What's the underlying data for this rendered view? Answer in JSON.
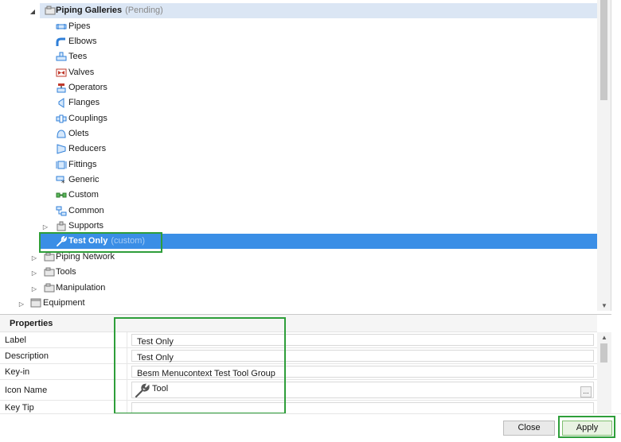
{
  "tree": {
    "nodes": [
      {
        "label": "Piping Galleries",
        "status": "(Pending)",
        "icon": "gallery-icon"
      },
      {
        "label": "Pipes",
        "icon": "pipe-icon"
      },
      {
        "label": "Elbows",
        "icon": "elbow-icon"
      },
      {
        "label": "Tees",
        "icon": "tee-icon"
      },
      {
        "label": "Valves",
        "icon": "valve-icon"
      },
      {
        "label": "Operators",
        "icon": "operator-icon"
      },
      {
        "label": "Flanges",
        "icon": "flange-icon"
      },
      {
        "label": "Couplings",
        "icon": "coupling-icon"
      },
      {
        "label": "Olets",
        "icon": "olet-icon"
      },
      {
        "label": "Reducers",
        "icon": "reducer-icon"
      },
      {
        "label": "Fittings",
        "icon": "fitting-icon"
      },
      {
        "label": "Generic",
        "icon": "generic-icon"
      },
      {
        "label": "Custom",
        "icon": "custom-icon"
      },
      {
        "label": "Common",
        "icon": "common-icon"
      },
      {
        "label": "Supports",
        "icon": "support-icon"
      },
      {
        "label": "Test Only",
        "status": "(custom)",
        "icon": "wrench-icon"
      },
      {
        "label": "Piping Network",
        "icon": "folder-icon"
      },
      {
        "label": "Tools",
        "icon": "folder-icon"
      },
      {
        "label": "Manipulation",
        "icon": "folder-icon"
      },
      {
        "label": "Equipment",
        "icon": "folder-icon"
      }
    ]
  },
  "properties": {
    "title": "Properties",
    "rows": [
      {
        "label": "Label",
        "value": "Test Only"
      },
      {
        "label": "Description",
        "value": "Test Only"
      },
      {
        "label": "Key-in",
        "value": "Besm Menucontext Test Tool Group"
      },
      {
        "label": "Icon Name",
        "value": "Tool",
        "icon": "wrench-icon",
        "button": "..."
      },
      {
        "label": "Key Tip",
        "value": ""
      }
    ]
  },
  "buttons": {
    "close": "Close",
    "apply": "Apply"
  },
  "colors": {
    "selection": "#3a8ee6",
    "pending_highlight": "#dbe6f4",
    "annotation": "#2e9e3a"
  }
}
